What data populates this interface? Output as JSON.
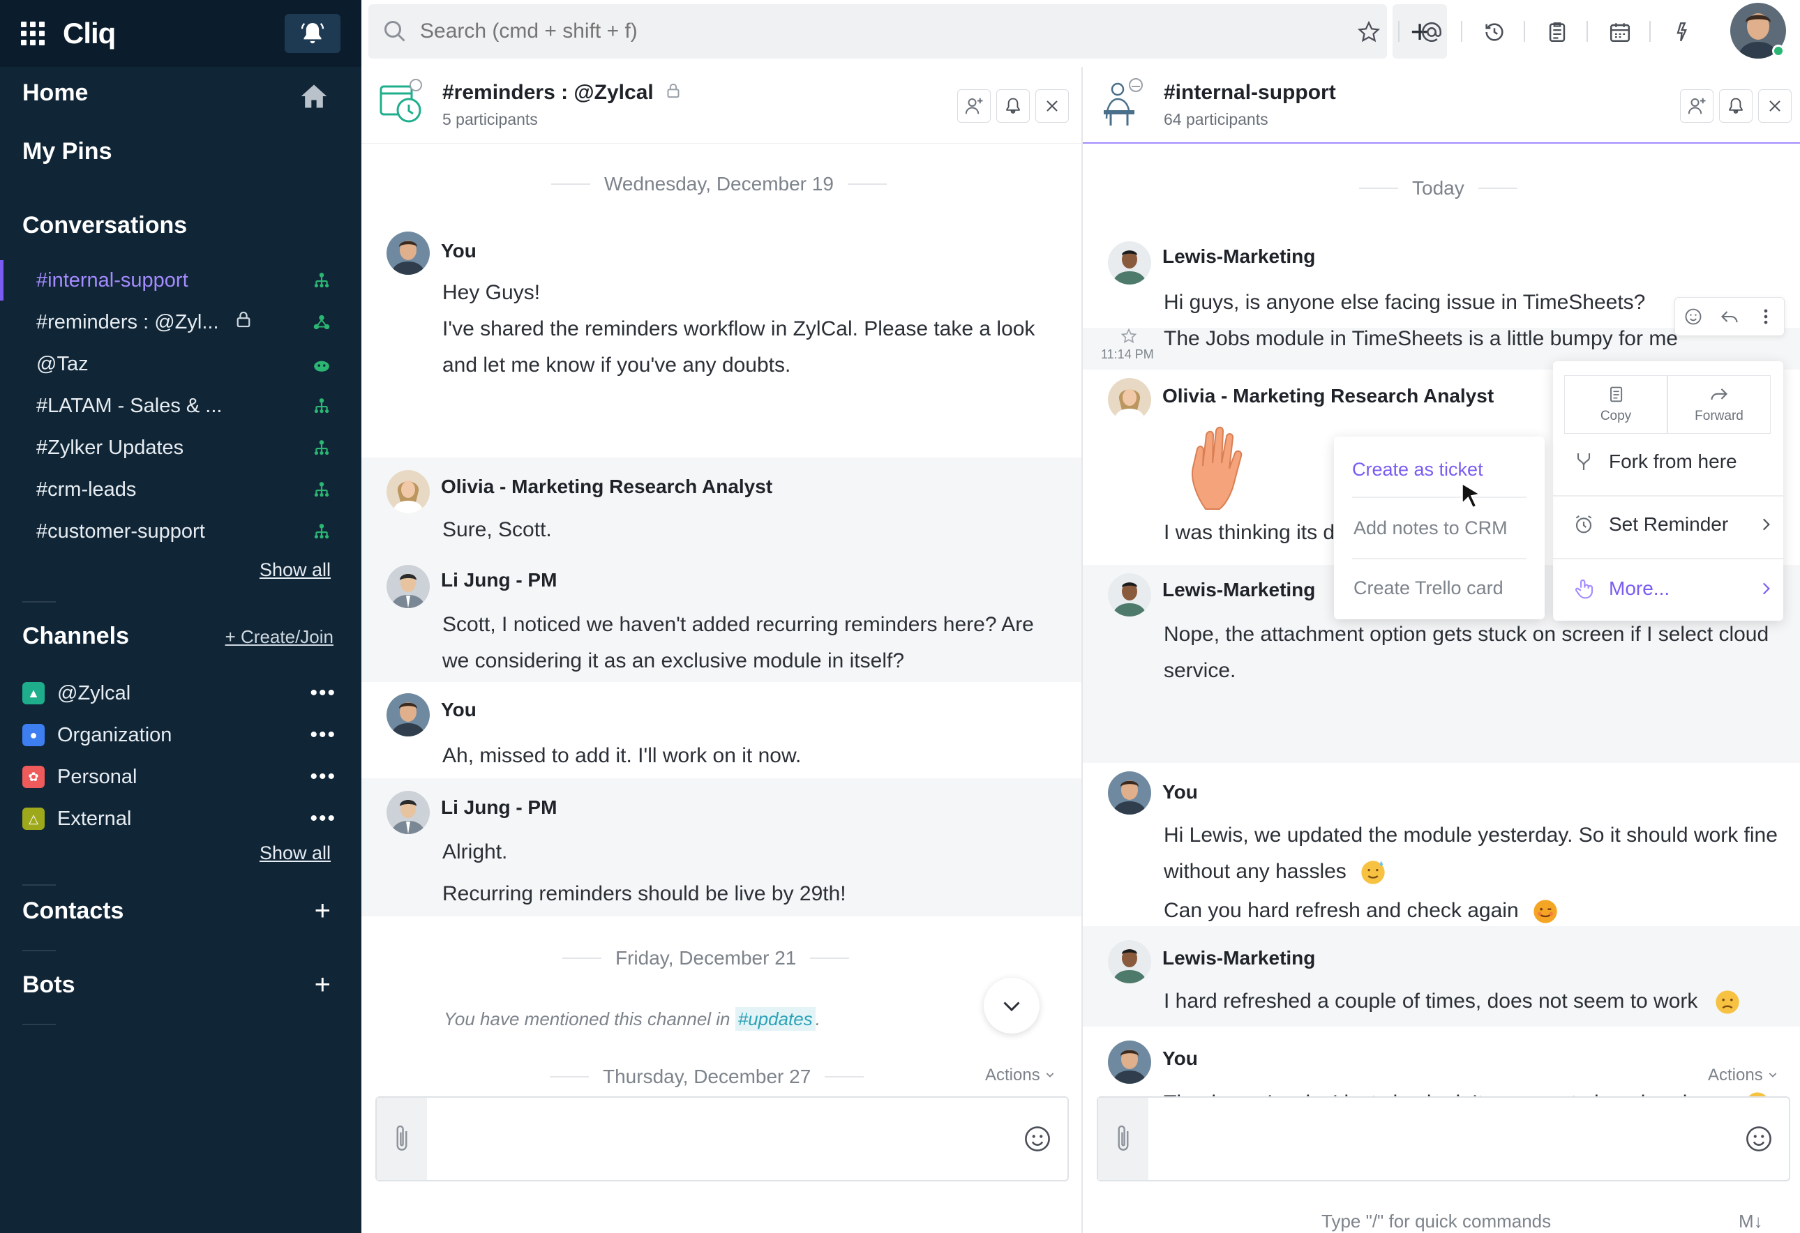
{
  "app": {
    "title": "Cliq"
  },
  "sidebar": {
    "home": "Home",
    "my_pins": "My Pins",
    "conversations_title": "Conversations",
    "conversations": [
      {
        "label": "#internal-support",
        "active": true,
        "locked": false
      },
      {
        "label": "#reminders : @Zyl...",
        "active": false,
        "locked": true
      },
      {
        "label": "@Taz",
        "active": false,
        "locked": false
      },
      {
        "label": "#LATAM - Sales & ...",
        "active": false,
        "locked": false
      },
      {
        "label": "#Zylker Updates",
        "active": false,
        "locked": false
      },
      {
        "label": "#crm-leads",
        "active": false,
        "locked": false
      },
      {
        "label": "#customer-support",
        "active": false,
        "locked": false
      }
    ],
    "show_all": "Show all",
    "channels_title": "Channels",
    "create_join": "+ Create/Join",
    "channels": [
      {
        "label": "@Zylcal",
        "color": "#1fae8c"
      },
      {
        "label": "Organization",
        "color": "#3d7ff0"
      },
      {
        "label": "Personal",
        "color": "#ef5b5b"
      },
      {
        "label": "External",
        "color": "#9ea81b"
      }
    ],
    "contacts_title": "Contacts",
    "bots_title": "Bots"
  },
  "topbar": {
    "search_placeholder": "Search (cmd + shift + f)",
    "icons": [
      "star-icon",
      "mention-icon",
      "history-icon",
      "notes-icon",
      "calendar-icon",
      "plugin-icon"
    ]
  },
  "left_panel": {
    "title": "#reminders : @Zylcal",
    "participants": "5 participants",
    "date1": "Wednesday, December 19",
    "messages": [
      {
        "name": "You",
        "lines": [
          "Hey Guys!",
          "I've shared the reminders workflow in ZylCal. Please take a look",
          "and let me know if you've any doubts."
        ]
      },
      {
        "name": "Olivia - Marketing Research Analyst",
        "lines": [
          "Sure, Scott."
        ]
      },
      {
        "name": "Li Jung - PM",
        "lines": [
          "Scott, I noticed we haven't added recurring reminders here? Are",
          "we considering it as an exclusive module in itself?"
        ]
      },
      {
        "name": "You",
        "lines": [
          "Ah, missed to add it. I'll work on it now."
        ]
      },
      {
        "name": "Li Jung - PM",
        "lines": [
          "Alright.",
          "Recurring reminders should be live by 29th!"
        ]
      }
    ],
    "date2": "Friday, December 21",
    "mention_text": "You have mentioned this channel in",
    "mention_tag": "#updates",
    "mention_end": ".",
    "date3": "Thursday, December 27",
    "actions": "Actions"
  },
  "right_panel": {
    "title": "#internal-support",
    "participants": "64 participants",
    "date": "Today",
    "messages": [
      {
        "name": "Lewis-Marketing",
        "lines": [
          "Hi guys, is anyone else facing issue in TimeSheets?"
        ]
      },
      {
        "time": "11:14 PM",
        "lines": [
          "The Jobs module in TimeSheets is a little bumpy for me"
        ]
      },
      {
        "name": "Olivia - Marketing Research Analyst",
        "lines": [
          "I was thinking its d"
        ]
      },
      {
        "name": "Lewis-Marketing",
        "lines": [
          "Nope, the attachment option gets stuck on screen if I select cloud",
          "service."
        ]
      },
      {
        "name": "You",
        "lines": [
          "Hi Lewis, we updated the module yesterday. So it should work fine",
          "without any hassles",
          "Can you hard refresh and check again"
        ]
      },
      {
        "name": "Lewis-Marketing",
        "lines": [
          "I hard refreshed a couple of times, does not seem to work"
        ]
      },
      {
        "name": "You",
        "lines": [
          "Thank you Lewis, I just checked. It appears to be a breakage"
        ]
      }
    ],
    "actions": "Actions",
    "quick_commands": "Type \"/\" for quick commands",
    "markdown": "M↓"
  },
  "context_menu": {
    "copy": "Copy",
    "forward": "Forward",
    "fork": "Fork from here",
    "reminder": "Set Reminder",
    "more": "More..."
  },
  "submenu": {
    "items": [
      "Create as ticket",
      "Add notes to CRM",
      "Create Trello card"
    ]
  },
  "colors": {
    "accent": "#7a5cf2",
    "sidebar": "#102536",
    "online": "#2bb673"
  }
}
